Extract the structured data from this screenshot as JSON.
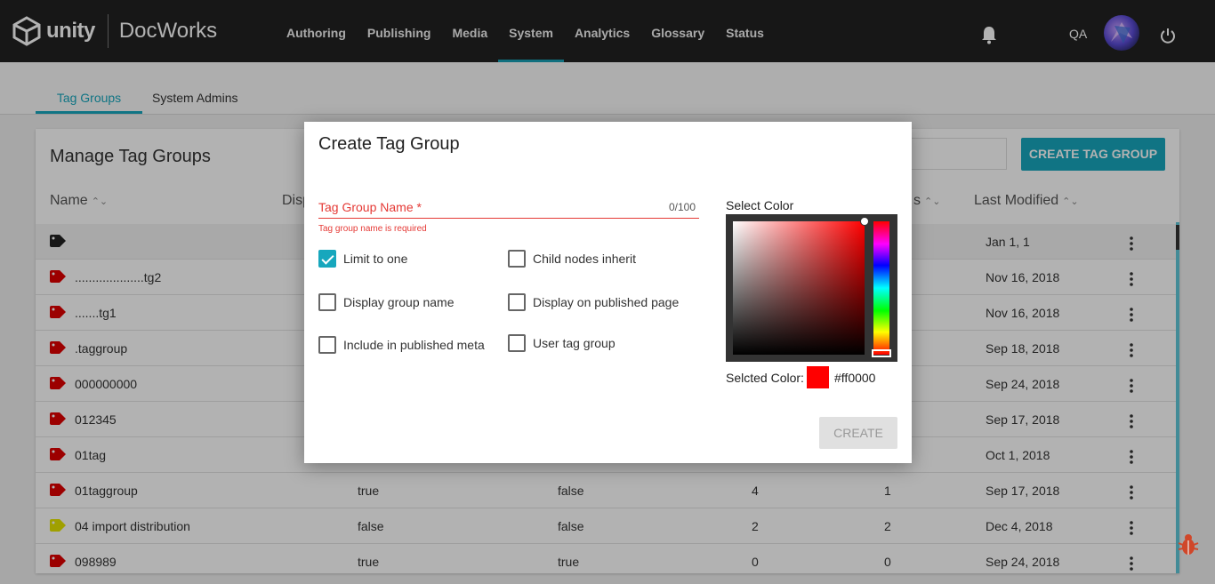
{
  "header": {
    "brand": "unity",
    "app_name": "DocWorks",
    "nav": [
      {
        "label": "Authoring"
      },
      {
        "label": "Publishing"
      },
      {
        "label": "Media"
      },
      {
        "label": "System",
        "active": true
      },
      {
        "label": "Analytics"
      },
      {
        "label": "Glossary"
      },
      {
        "label": "Status"
      }
    ],
    "user": "QA"
  },
  "subtabs": [
    "Tag Groups",
    "System Admins"
  ],
  "card": {
    "title": "Manage Tag Groups",
    "create_button": "CREATE TAG GROUP",
    "columns": [
      "Name",
      "Disp",
      "s",
      "Last Modified"
    ],
    "rows": [
      {
        "name": "",
        "c1": "",
        "c2": "",
        "c3": "",
        "c4": "",
        "modified": "Jan 1, 1",
        "tag_color": "#222222"
      },
      {
        "name": "....................tg2",
        "c1": "",
        "c2": "",
        "c3": "",
        "c4": "",
        "modified": "Nov 16, 2018",
        "tag_color": "#e00000"
      },
      {
        "name": ".......tg1",
        "c1": "",
        "c2": "",
        "c3": "",
        "c4": "",
        "modified": "Nov 16, 2018",
        "tag_color": "#e00000"
      },
      {
        "name": ".taggroup",
        "c1": "",
        "c2": "",
        "c3": "",
        "c4": "",
        "modified": "Sep 18, 2018",
        "tag_color": "#e00000"
      },
      {
        "name": "000000000",
        "c1": "",
        "c2": "",
        "c3": "",
        "c4": "",
        "modified": "Sep 24, 2018",
        "tag_color": "#e00000"
      },
      {
        "name": "012345",
        "c1": "",
        "c2": "",
        "c3": "",
        "c4": "",
        "modified": "Sep 17, 2018",
        "tag_color": "#e00000"
      },
      {
        "name": "01tag",
        "c1": "",
        "c2": "",
        "c3": "",
        "c4": "",
        "modified": "Oct 1, 2018",
        "tag_color": "#e00000"
      },
      {
        "name": "01taggroup",
        "c1": "true",
        "c2": "false",
        "c3": "4",
        "c4": "1",
        "modified": "Sep 17, 2018",
        "tag_color": "#e00000"
      },
      {
        "name": "04 import distribution",
        "c1": "false",
        "c2": "false",
        "c3": "2",
        "c4": "2",
        "modified": "Dec 4, 2018",
        "tag_color": "#e6e600"
      },
      {
        "name": "098989",
        "c1": "true",
        "c2": "true",
        "c3": "0",
        "c4": "0",
        "modified": "Sep 24, 2018",
        "tag_color": "#e00000"
      }
    ]
  },
  "modal": {
    "title": "Create Tag Group",
    "field_label": "Tag Group Name *",
    "field_count": "0/100",
    "field_error": "Tag group name is required",
    "checkboxes": [
      {
        "label": "Limit to one",
        "checked": true
      },
      {
        "label": "Child nodes inherit",
        "checked": false
      },
      {
        "label": "Display group name",
        "checked": false
      },
      {
        "label": "Display on published page",
        "checked": false
      },
      {
        "label": "Include in published meta",
        "checked": false
      },
      {
        "label": "User tag group",
        "checked": false
      }
    ],
    "select_color_label": "Select Color",
    "selected_color_label": "Selcted Color:",
    "selected_color_hex": "#ff0000",
    "create_button": "CREATE"
  },
  "colors": {
    "accent": "#17a7bd",
    "error": "#e53935",
    "topbar": "#222222"
  }
}
